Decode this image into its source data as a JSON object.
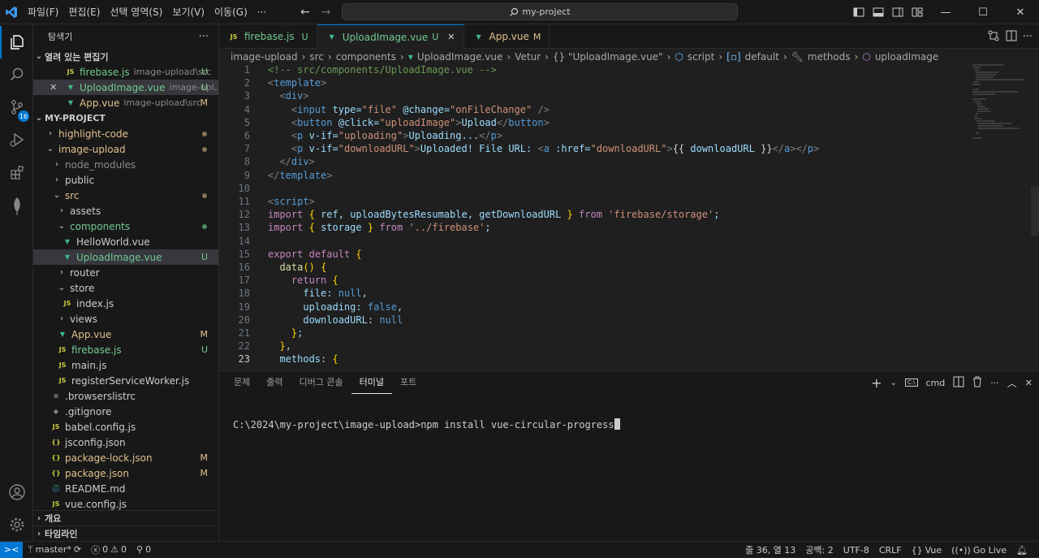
{
  "menu": [
    "파일(F)",
    "편집(E)",
    "선택 영역(S)",
    "보기(V)",
    "이동(G)",
    "···"
  ],
  "search": {
    "text": "my-project"
  },
  "explorer": {
    "title": "탐색기",
    "more": "···"
  },
  "open_editors": {
    "title": "열려 있는 편집기",
    "items": [
      {
        "icon": "JS",
        "name": "firebase.js",
        "path": "image-upload\\src",
        "status": "U"
      },
      {
        "icon": "vue",
        "close": "✕",
        "name": "UploadImage.vue",
        "path": "image-upl...",
        "status": "U"
      },
      {
        "icon": "vue",
        "name": "App.vue",
        "path": "image-upload\\src",
        "status": "M"
      }
    ]
  },
  "project": {
    "title": "MY-PROJECT",
    "tree": [
      {
        "name": "highlight-code",
        "type": "folder",
        "state": "closed"
      },
      {
        "name": "image-upload",
        "type": "folder",
        "state": "open"
      },
      {
        "name": "node_modules",
        "type": "folder",
        "state": "closed"
      },
      {
        "name": "public",
        "type": "folder",
        "state": "closed"
      },
      {
        "name": "src",
        "type": "folder",
        "state": "open"
      },
      {
        "name": "assets",
        "type": "folder",
        "state": "closed"
      },
      {
        "name": "components",
        "type": "folder",
        "state": "open"
      },
      {
        "name": "HelloWorld.vue",
        "type": "vue"
      },
      {
        "name": "UploadImage.vue",
        "type": "vue",
        "status": "U"
      },
      {
        "name": "router",
        "type": "folder",
        "state": "closed"
      },
      {
        "name": "store",
        "type": "folder",
        "state": "open"
      },
      {
        "name": "index.js",
        "type": "js"
      },
      {
        "name": "views",
        "type": "folder",
        "state": "closed"
      },
      {
        "name": "App.vue",
        "type": "vue",
        "status": "M"
      },
      {
        "name": "firebase.js",
        "type": "js",
        "status": "U"
      },
      {
        "name": "main.js",
        "type": "js"
      },
      {
        "name": "registerServiceWorker.js",
        "type": "js"
      },
      {
        "name": ".browserslistrc",
        "type": "text"
      },
      {
        "name": ".gitignore",
        "type": "git"
      },
      {
        "name": "babel.config.js",
        "type": "js"
      },
      {
        "name": "jsconfig.json",
        "type": "json"
      },
      {
        "name": "package-lock.json",
        "type": "json",
        "status": "M"
      },
      {
        "name": "package.json",
        "type": "json",
        "status": "M"
      },
      {
        "name": "README.md",
        "type": "info"
      },
      {
        "name": "vue.config.js",
        "type": "js"
      }
    ]
  },
  "outline": {
    "title": "개요"
  },
  "timeline": {
    "title": "타임라인"
  },
  "tabs": [
    {
      "icon": "JS",
      "label": "firebase.js",
      "status": "U"
    },
    {
      "icon": "vue",
      "label": "UploadImage.vue",
      "status": "U",
      "active": true,
      "close": "✕"
    },
    {
      "icon": "vue",
      "label": "App.vue",
      "status": "M"
    }
  ],
  "breadcrumb": [
    "image-upload",
    "src",
    "components",
    "UploadImage.vue",
    "Vetur",
    "{} \"UploadImage.vue\"",
    "script",
    "default",
    "methods",
    "uploadImage"
  ],
  "code": {
    "line_numbers": [
      "1",
      "2",
      "3",
      "4",
      "5",
      "6",
      "7",
      "8",
      "9",
      "10",
      "11",
      "12",
      "13",
      "14",
      "15",
      "16",
      "17",
      "18",
      "19",
      "20",
      "21",
      "22",
      "23"
    ],
    "lines": [
      "<!-- src/components/UploadImage.vue -->",
      "<template>",
      "  <div>",
      "    <input type=\"file\" @change=\"onFileChange\" />",
      "    <button @click=\"uploadImage\">Upload</button>",
      "    <p v-if=\"uploading\">Uploading...</p>",
      "    <p v-if=\"downloadURL\">Uploaded! File URL: <a :href=\"downloadURL\">{{ downloadURL }}</a></p>",
      "  </div>",
      "</template>",
      "",
      "<script>",
      "import { ref, uploadBytesResumable, getDownloadURL } from 'firebase/storage';",
      "import { storage } from '../firebase';",
      "",
      "export default {",
      "  data() {",
      "    return {",
      "      file: null,",
      "      uploading: false,",
      "      downloadURL: null",
      "    };",
      "  },",
      "  methods: {"
    ]
  },
  "panel": {
    "tabs": [
      "문제",
      "출력",
      "디버그 콘솔",
      "터미널",
      "포트"
    ],
    "active_tab": "터미널",
    "shell": "cmd",
    "terminal_line": "C:\\2024\\my-project\\image-upload>npm install vue-circular-progress"
  },
  "status": {
    "branch": "master*",
    "errors": "0",
    "warnings": "0",
    "ports": "0",
    "position": "줄 36, 열 13",
    "spaces": "공백: 2",
    "encoding": "UTF-8",
    "eol": "CRLF",
    "language": "Vue",
    "golive": "Go Live"
  },
  "colors": {
    "accent": "#0078d4",
    "untracked": "#73c991",
    "modified": "#e2c08d"
  }
}
